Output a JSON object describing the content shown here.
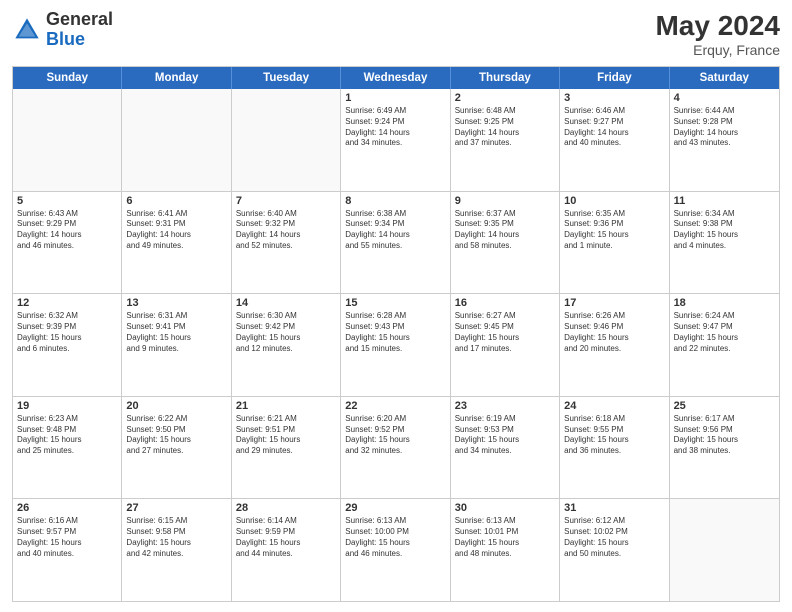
{
  "header": {
    "logo_general": "General",
    "logo_blue": "Blue",
    "month_year": "May 2024",
    "location": "Erquy, France"
  },
  "days_of_week": [
    "Sunday",
    "Monday",
    "Tuesday",
    "Wednesday",
    "Thursday",
    "Friday",
    "Saturday"
  ],
  "weeks": [
    [
      {
        "day": "",
        "info": ""
      },
      {
        "day": "",
        "info": ""
      },
      {
        "day": "",
        "info": ""
      },
      {
        "day": "1",
        "info": "Sunrise: 6:49 AM\nSunset: 9:24 PM\nDaylight: 14 hours\nand 34 minutes."
      },
      {
        "day": "2",
        "info": "Sunrise: 6:48 AM\nSunset: 9:25 PM\nDaylight: 14 hours\nand 37 minutes."
      },
      {
        "day": "3",
        "info": "Sunrise: 6:46 AM\nSunset: 9:27 PM\nDaylight: 14 hours\nand 40 minutes."
      },
      {
        "day": "4",
        "info": "Sunrise: 6:44 AM\nSunset: 9:28 PM\nDaylight: 14 hours\nand 43 minutes."
      }
    ],
    [
      {
        "day": "5",
        "info": "Sunrise: 6:43 AM\nSunset: 9:29 PM\nDaylight: 14 hours\nand 46 minutes."
      },
      {
        "day": "6",
        "info": "Sunrise: 6:41 AM\nSunset: 9:31 PM\nDaylight: 14 hours\nand 49 minutes."
      },
      {
        "day": "7",
        "info": "Sunrise: 6:40 AM\nSunset: 9:32 PM\nDaylight: 14 hours\nand 52 minutes."
      },
      {
        "day": "8",
        "info": "Sunrise: 6:38 AM\nSunset: 9:34 PM\nDaylight: 14 hours\nand 55 minutes."
      },
      {
        "day": "9",
        "info": "Sunrise: 6:37 AM\nSunset: 9:35 PM\nDaylight: 14 hours\nand 58 minutes."
      },
      {
        "day": "10",
        "info": "Sunrise: 6:35 AM\nSunset: 9:36 PM\nDaylight: 15 hours\nand 1 minute."
      },
      {
        "day": "11",
        "info": "Sunrise: 6:34 AM\nSunset: 9:38 PM\nDaylight: 15 hours\nand 4 minutes."
      }
    ],
    [
      {
        "day": "12",
        "info": "Sunrise: 6:32 AM\nSunset: 9:39 PM\nDaylight: 15 hours\nand 6 minutes."
      },
      {
        "day": "13",
        "info": "Sunrise: 6:31 AM\nSunset: 9:41 PM\nDaylight: 15 hours\nand 9 minutes."
      },
      {
        "day": "14",
        "info": "Sunrise: 6:30 AM\nSunset: 9:42 PM\nDaylight: 15 hours\nand 12 minutes."
      },
      {
        "day": "15",
        "info": "Sunrise: 6:28 AM\nSunset: 9:43 PM\nDaylight: 15 hours\nand 15 minutes."
      },
      {
        "day": "16",
        "info": "Sunrise: 6:27 AM\nSunset: 9:45 PM\nDaylight: 15 hours\nand 17 minutes."
      },
      {
        "day": "17",
        "info": "Sunrise: 6:26 AM\nSunset: 9:46 PM\nDaylight: 15 hours\nand 20 minutes."
      },
      {
        "day": "18",
        "info": "Sunrise: 6:24 AM\nSunset: 9:47 PM\nDaylight: 15 hours\nand 22 minutes."
      }
    ],
    [
      {
        "day": "19",
        "info": "Sunrise: 6:23 AM\nSunset: 9:48 PM\nDaylight: 15 hours\nand 25 minutes."
      },
      {
        "day": "20",
        "info": "Sunrise: 6:22 AM\nSunset: 9:50 PM\nDaylight: 15 hours\nand 27 minutes."
      },
      {
        "day": "21",
        "info": "Sunrise: 6:21 AM\nSunset: 9:51 PM\nDaylight: 15 hours\nand 29 minutes."
      },
      {
        "day": "22",
        "info": "Sunrise: 6:20 AM\nSunset: 9:52 PM\nDaylight: 15 hours\nand 32 minutes."
      },
      {
        "day": "23",
        "info": "Sunrise: 6:19 AM\nSunset: 9:53 PM\nDaylight: 15 hours\nand 34 minutes."
      },
      {
        "day": "24",
        "info": "Sunrise: 6:18 AM\nSunset: 9:55 PM\nDaylight: 15 hours\nand 36 minutes."
      },
      {
        "day": "25",
        "info": "Sunrise: 6:17 AM\nSunset: 9:56 PM\nDaylight: 15 hours\nand 38 minutes."
      }
    ],
    [
      {
        "day": "26",
        "info": "Sunrise: 6:16 AM\nSunset: 9:57 PM\nDaylight: 15 hours\nand 40 minutes."
      },
      {
        "day": "27",
        "info": "Sunrise: 6:15 AM\nSunset: 9:58 PM\nDaylight: 15 hours\nand 42 minutes."
      },
      {
        "day": "28",
        "info": "Sunrise: 6:14 AM\nSunset: 9:59 PM\nDaylight: 15 hours\nand 44 minutes."
      },
      {
        "day": "29",
        "info": "Sunrise: 6:13 AM\nSunset: 10:00 PM\nDaylight: 15 hours\nand 46 minutes."
      },
      {
        "day": "30",
        "info": "Sunrise: 6:13 AM\nSunset: 10:01 PM\nDaylight: 15 hours\nand 48 minutes."
      },
      {
        "day": "31",
        "info": "Sunrise: 6:12 AM\nSunset: 10:02 PM\nDaylight: 15 hours\nand 50 minutes."
      },
      {
        "day": "",
        "info": ""
      }
    ]
  ]
}
